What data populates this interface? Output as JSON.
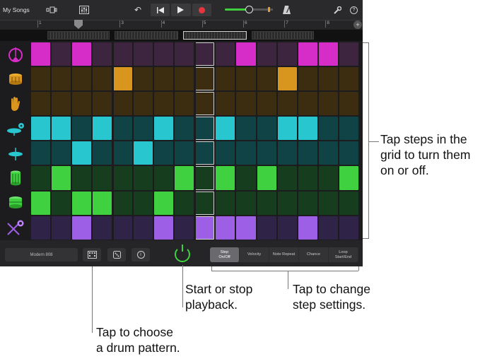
{
  "toolbar": {
    "my_songs": "My Songs",
    "tracks_icon": "tracks-view-icon",
    "mixer_icon": "mixer-icon",
    "undo_icon": "undo-icon",
    "rewind_icon": "rewind-icon",
    "play_icon": "play-icon",
    "record_icon": "record-icon",
    "metronome_icon": "metronome-icon",
    "settings_icon": "wrench-icon",
    "help": "?"
  },
  "ruler": {
    "bars": [
      "1",
      "2",
      "3",
      "4",
      "5",
      "6",
      "7",
      "8"
    ],
    "add_label": "+"
  },
  "instruments": [
    "tambourine",
    "snare",
    "clap",
    "cymbal",
    "hi-hat",
    "tom",
    "kick",
    "sticks"
  ],
  "grid": {
    "rows": [
      [
        1,
        0,
        1,
        0,
        0,
        0,
        0,
        0,
        0,
        0,
        1,
        0,
        0,
        1,
        1,
        0
      ],
      [
        0,
        0,
        0,
        0,
        1,
        0,
        0,
        0,
        0,
        0,
        0,
        0,
        1,
        0,
        0,
        0
      ],
      [
        0,
        0,
        0,
        0,
        0,
        0,
        0,
        0,
        0,
        0,
        0,
        0,
        0,
        0,
        0,
        0
      ],
      [
        1,
        1,
        0,
        1,
        0,
        0,
        1,
        0,
        0,
        1,
        0,
        0,
        1,
        1,
        0,
        0
      ],
      [
        0,
        0,
        1,
        0,
        0,
        1,
        0,
        0,
        0,
        0,
        0,
        0,
        0,
        0,
        0,
        0
      ],
      [
        0,
        1,
        0,
        0,
        0,
        0,
        0,
        1,
        0,
        1,
        0,
        1,
        0,
        0,
        0,
        1
      ],
      [
        1,
        0,
        1,
        1,
        0,
        0,
        1,
        0,
        0,
        0,
        0,
        0,
        0,
        0,
        0,
        0
      ],
      [
        0,
        0,
        1,
        0,
        0,
        0,
        1,
        0,
        1,
        1,
        1,
        0,
        0,
        1,
        0,
        0
      ]
    ],
    "playhead_step": 8,
    "colors": {
      "pink": "#d62cc8",
      "orange": "#d9961e",
      "cyan": "#28c6cf",
      "green": "#3fd13f",
      "purple": "#9c5fe6"
    }
  },
  "bottombar": {
    "pattern_name": "Modern 808",
    "pattern_icon": "drum-pattern-icon",
    "dice_icon": "dice-icon",
    "info": "i",
    "power_icon": "power-icon",
    "settings": [
      {
        "label": "Step\nOn/Off",
        "active": true
      },
      {
        "label": "Velocity",
        "active": false
      },
      {
        "label": "Note Repeat",
        "active": false
      },
      {
        "label": "Chance",
        "active": false
      },
      {
        "label": "Loop\nStart/End",
        "active": false
      }
    ]
  },
  "callouts": {
    "grid": "Tap steps in the\ngrid to turn them\non or off.",
    "playback": "Start or stop\nplayback.",
    "settings": "Tap to change\nstep settings.",
    "pattern": "Tap to choose\na drum pattern."
  }
}
